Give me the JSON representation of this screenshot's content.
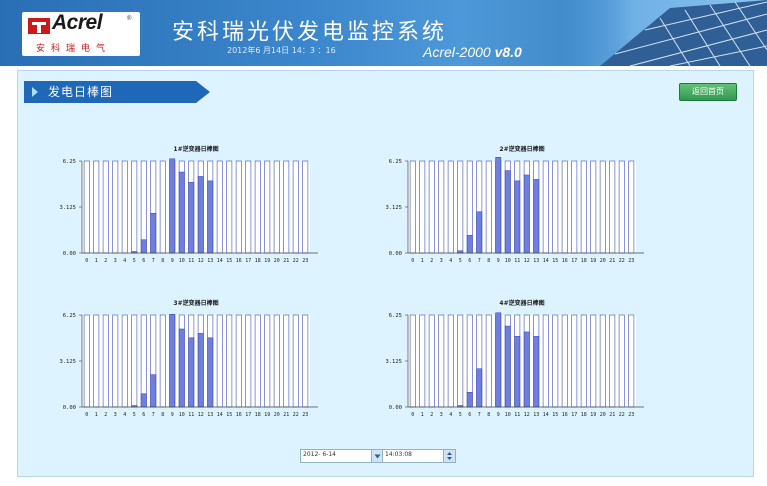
{
  "header": {
    "logo_text": "Acrel",
    "logo_reg": "®",
    "logo_sub": "安科瑞电气",
    "title": "安科瑞光伏发电监控系统",
    "datetime": "2012年6 月14日 14：3 ：16",
    "version_prefix": "Acrel-2000",
    "version_suffix": "v8.0"
  },
  "section": {
    "title": "发电日棒图",
    "back_label": "返回首页"
  },
  "controls": {
    "date_value": "2012- 6-14",
    "time_value": "14:03:08"
  },
  "colors": {
    "header_bg": "#3b86cc",
    "content_bg": "#ddf3ff",
    "banner": "#1f68b8",
    "bar_fill": "#6f7fe0",
    "bar_stroke": "#3240b0",
    "back_button": "#3aa458"
  },
  "chart_data": [
    {
      "type": "bar",
      "title": "1#逆变器日棒图",
      "categories": [
        "0",
        "1",
        "2",
        "3",
        "4",
        "5",
        "6",
        "7",
        "8",
        "9",
        "10",
        "11",
        "12",
        "13",
        "14",
        "15",
        "16",
        "17",
        "18",
        "19",
        "20",
        "21",
        "22",
        "23"
      ],
      "values": [
        0,
        0,
        0,
        0,
        0,
        0.1,
        0.9,
        2.7,
        0,
        6.4,
        5.5,
        4.8,
        5.2,
        4.9,
        0,
        0,
        0,
        0,
        0,
        0,
        0,
        0,
        0,
        0
      ],
      "yticks": [
        "0.00",
        "3.125",
        "6.25"
      ],
      "ylim": [
        0,
        6.25
      ]
    },
    {
      "type": "bar",
      "title": "2#逆变器日棒图",
      "categories": [
        "0",
        "1",
        "2",
        "3",
        "4",
        "5",
        "6",
        "7",
        "8",
        "9",
        "10",
        "11",
        "12",
        "13",
        "14",
        "15",
        "16",
        "17",
        "18",
        "19",
        "20",
        "21",
        "22",
        "23"
      ],
      "values": [
        0,
        0,
        0,
        0,
        0,
        0.15,
        1.2,
        2.8,
        0,
        6.5,
        5.6,
        4.9,
        5.3,
        5.0,
        0,
        0,
        0,
        0,
        0,
        0,
        0,
        0,
        0,
        0
      ],
      "yticks": [
        "0.00",
        "3.125",
        "6.25"
      ],
      "ylim": [
        0,
        6.25
      ]
    },
    {
      "type": "bar",
      "title": "3#逆变器日棒图",
      "categories": [
        "0",
        "1",
        "2",
        "3",
        "4",
        "5",
        "6",
        "7",
        "8",
        "9",
        "10",
        "11",
        "12",
        "13",
        "14",
        "15",
        "16",
        "17",
        "18",
        "19",
        "20",
        "21",
        "22",
        "23"
      ],
      "values": [
        0,
        0,
        0,
        0,
        0,
        0.1,
        0.9,
        2.2,
        0,
        6.3,
        5.3,
        4.7,
        5.0,
        4.7,
        0,
        0,
        0,
        0,
        0,
        0,
        0,
        0,
        0,
        0
      ],
      "yticks": [
        "0.00",
        "3.125",
        "6.25"
      ],
      "ylim": [
        0,
        6.25
      ]
    },
    {
      "type": "bar",
      "title": "4#逆变器日棒图",
      "categories": [
        "0",
        "1",
        "2",
        "3",
        "4",
        "5",
        "6",
        "7",
        "8",
        "9",
        "10",
        "11",
        "12",
        "13",
        "14",
        "15",
        "16",
        "17",
        "18",
        "19",
        "20",
        "21",
        "22",
        "23"
      ],
      "values": [
        0,
        0,
        0,
        0,
        0,
        0.1,
        1.0,
        2.6,
        0,
        6.4,
        5.5,
        4.8,
        5.1,
        4.8,
        0,
        0,
        0,
        0,
        0,
        0,
        0,
        0,
        0,
        0
      ],
      "yticks": [
        "0.00",
        "3.125",
        "6.25"
      ],
      "ylim": [
        0,
        6.25
      ]
    }
  ]
}
